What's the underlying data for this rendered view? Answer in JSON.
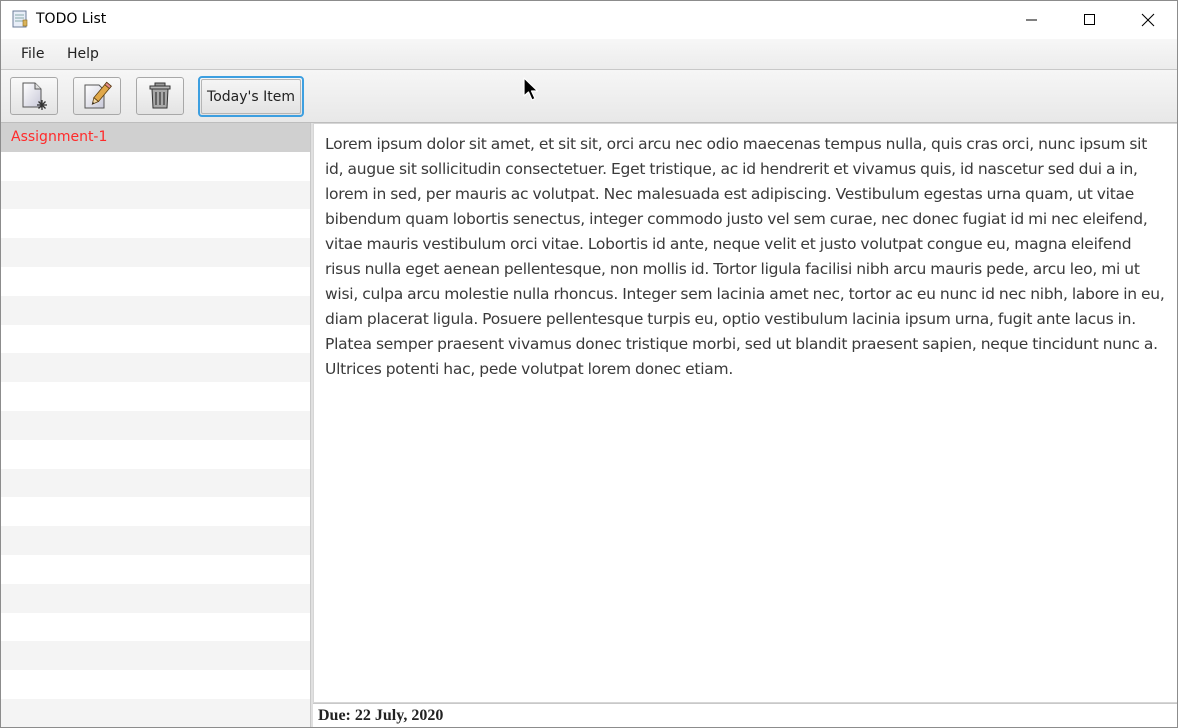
{
  "window": {
    "title": "TODO List"
  },
  "menu": {
    "file": "File",
    "help": "Help"
  },
  "toolbar": {
    "today_label": "Today's Item",
    "new_icon": "new-document-icon",
    "edit_icon": "edit-pencil-icon",
    "delete_icon": "trash-can-icon"
  },
  "todo_list": {
    "items": [
      {
        "label": "Assignment-1",
        "selected": true
      }
    ],
    "selected_text_color": "#ff2a2a"
  },
  "detail": {
    "description": "Lorem ipsum dolor sit amet, et sit sit, orci arcu nec odio maecenas tempus nulla, quis cras orci, nunc ipsum sit id, augue sit sollicitudin consectetuer. Eget tristique, ac id hendrerit et vivamus quis, id nascetur sed dui a in, lorem in sed, per mauris ac volutpat. Nec malesuada est adipiscing. Vestibulum egestas urna quam, ut vitae bibendum quam lobortis senectus, integer commodo justo vel sem curae, nec donec fugiat id mi nec eleifend, vitae mauris vestibulum orci vitae. Lobortis id ante, neque velit et justo volutpat congue eu, magna eleifend risus nulla eget aenean pellentesque, non mollis id. Tortor ligula facilisi nibh arcu mauris pede, arcu leo, mi ut wisi, culpa arcu molestie nulla rhoncus. Integer sem lacinia amet nec, tortor ac eu nunc id nec nibh, labore in eu, diam placerat ligula. Posuere pellentesque turpis eu, optio vestibulum lacinia ipsum urna, fugit ante lacus in. Platea semper praesent vivamus donec tristique morbi, sed ut blandit praesent sapien, neque tincidunt nunc a. Ultrices potenti hac, pede volutpat lorem donec etiam.",
    "due": "Due: 22 July, 2020"
  },
  "colors": {
    "focus_ring": "#3d9fe0"
  }
}
